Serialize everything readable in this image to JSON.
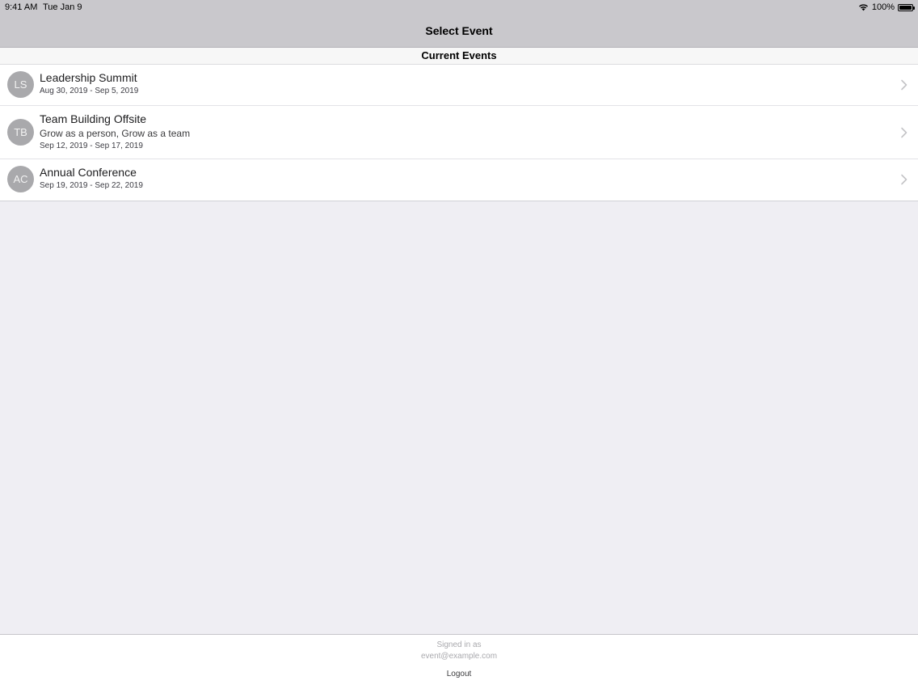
{
  "status_bar": {
    "time": "9:41 AM",
    "date": "Tue Jan 9",
    "battery_text": "100%",
    "battery_level": 1.0
  },
  "nav": {
    "title": "Select Event"
  },
  "section": {
    "header": "Current Events"
  },
  "events": [
    {
      "initials": "LS",
      "title": "Leadership Summit",
      "subtitle": "",
      "dates": "Aug 30, 2019 - Sep 5, 2019"
    },
    {
      "initials": "TB",
      "title": "Team Building Offsite",
      "subtitle": "Grow as a person, Grow as a team",
      "dates": "Sep 12, 2019 - Sep 17, 2019"
    },
    {
      "initials": "AC",
      "title": "Annual Conference",
      "subtitle": "",
      "dates": "Sep 19, 2019 - Sep 22, 2019"
    }
  ],
  "footer": {
    "signed_in_label": "Signed in as",
    "email": "event@example.com",
    "logout_label": "Logout"
  },
  "colors": {
    "background": "#efeef3",
    "nav_bar": "#c9c8cc",
    "avatar": "#a9a9ac",
    "chevron": "#c4c4c7"
  }
}
